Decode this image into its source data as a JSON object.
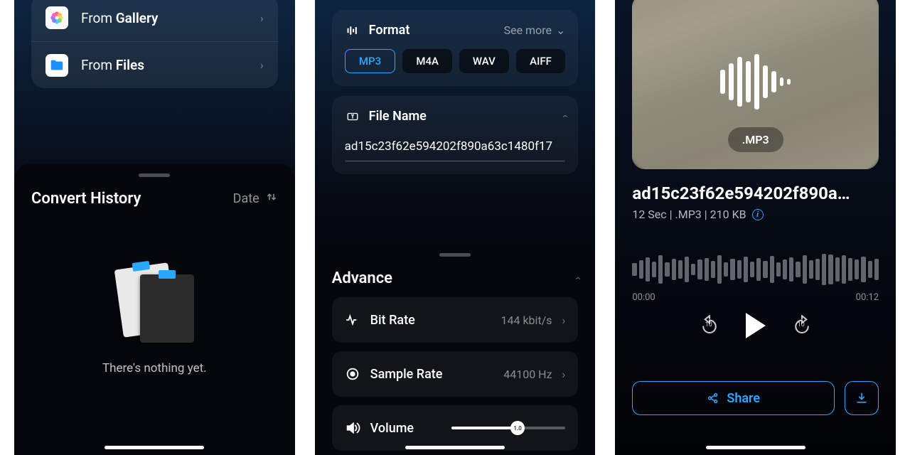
{
  "screen1": {
    "sources": {
      "gallery_prefix": "From ",
      "gallery_bold": "Gallery",
      "files_prefix": "From ",
      "files_bold": "Files"
    },
    "history": {
      "title": "Convert History",
      "sort_label": "Date",
      "empty_text": "There's nothing yet."
    }
  },
  "screen2": {
    "format": {
      "title": "Format",
      "see_more": "See more",
      "options": [
        "MP3",
        "M4A",
        "WAV",
        "AIFF"
      ],
      "selected": "MP3"
    },
    "filename": {
      "title": "File Name",
      "value": "ad15c23f62e594202f890a63c1480f17"
    },
    "advance": {
      "title": "Advance",
      "bitrate_label": "Bit Rate",
      "bitrate_value": "144 kbit/s",
      "samplerate_label": "Sample Rate",
      "samplerate_value": "44100 Hz",
      "volume_label": "Volume",
      "volume_value": "1.0"
    }
  },
  "screen3": {
    "ext_badge": ".MP3",
    "title": "ad15c23f62e594202f890a…",
    "meta": "12 Sec | .MP3 | 210 KB",
    "time_start": "00:00",
    "time_end": "00:12",
    "skip_label": "10",
    "share_label": "Share"
  }
}
